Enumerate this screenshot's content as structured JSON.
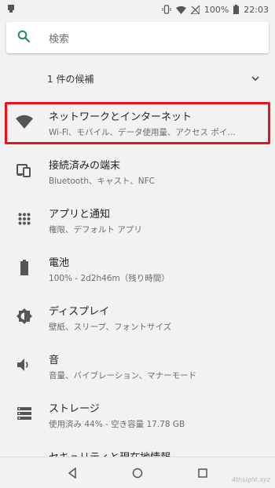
{
  "status_bar": {
    "battery_percent": "100%",
    "time": "22:03"
  },
  "search": {
    "placeholder": "検索"
  },
  "suggestion": {
    "label": "1 件の候補"
  },
  "settings": [
    {
      "title": "ネットワークとインターネット",
      "subtitle": "Wi-Fi、モバイル、データ使用量、アクセス ポイ…",
      "icon": "wifi-icon"
    },
    {
      "title": "接続済みの端末",
      "subtitle": "Bluetooth、キャスト、NFC",
      "icon": "devices-icon"
    },
    {
      "title": "アプリと通知",
      "subtitle": "権限、デフォルト アプリ",
      "icon": "apps-grid-icon"
    },
    {
      "title": "電池",
      "subtitle": "100% - 2d2h46m（残り時間）",
      "icon": "battery-icon"
    },
    {
      "title": "ディスプレイ",
      "subtitle": "壁紙、スリープ、フォントサイズ",
      "icon": "brightness-icon"
    },
    {
      "title": "音",
      "subtitle": "音量、バイブレーション、マナーモード",
      "icon": "volume-icon"
    },
    {
      "title": "ストレージ",
      "subtitle": "使用済み 44% - 空き容量 17.78 GB",
      "icon": "storage-icon"
    },
    {
      "title": "セキュリティと現在地情報",
      "subtitle": "",
      "icon": "lock-icon"
    }
  ],
  "highlight_color": "#e8141c",
  "accent_color": "#1a8a7a",
  "watermark": "4thsight.xyz"
}
